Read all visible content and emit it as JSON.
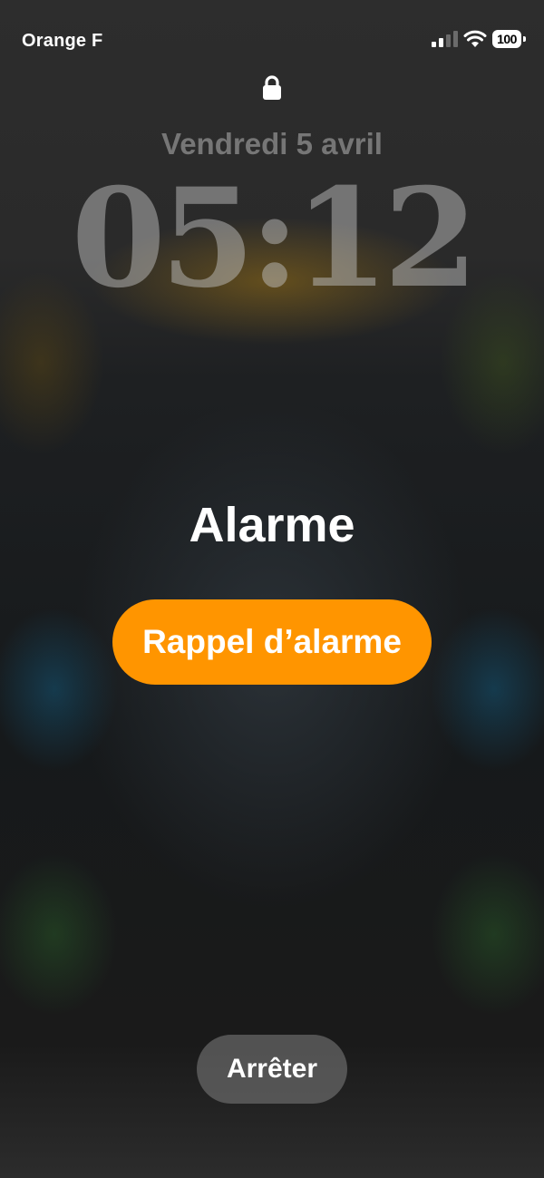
{
  "status_bar": {
    "carrier": "Orange F",
    "battery_level": "100",
    "signal_icon": "cellular-signal-icon",
    "wifi_icon": "wifi-icon",
    "battery_icon": "battery-icon"
  },
  "lock_screen": {
    "lock_icon": "lock-icon",
    "date": "Vendredi 5 avril",
    "time": "05:12"
  },
  "alarm": {
    "title": "Alarme",
    "snooze_label": "Rappel d’alarme",
    "stop_label": "Arrêter"
  },
  "colors": {
    "accent": "#ff9500",
    "stop_button_bg": "#787878",
    "text": "#ffffff"
  }
}
